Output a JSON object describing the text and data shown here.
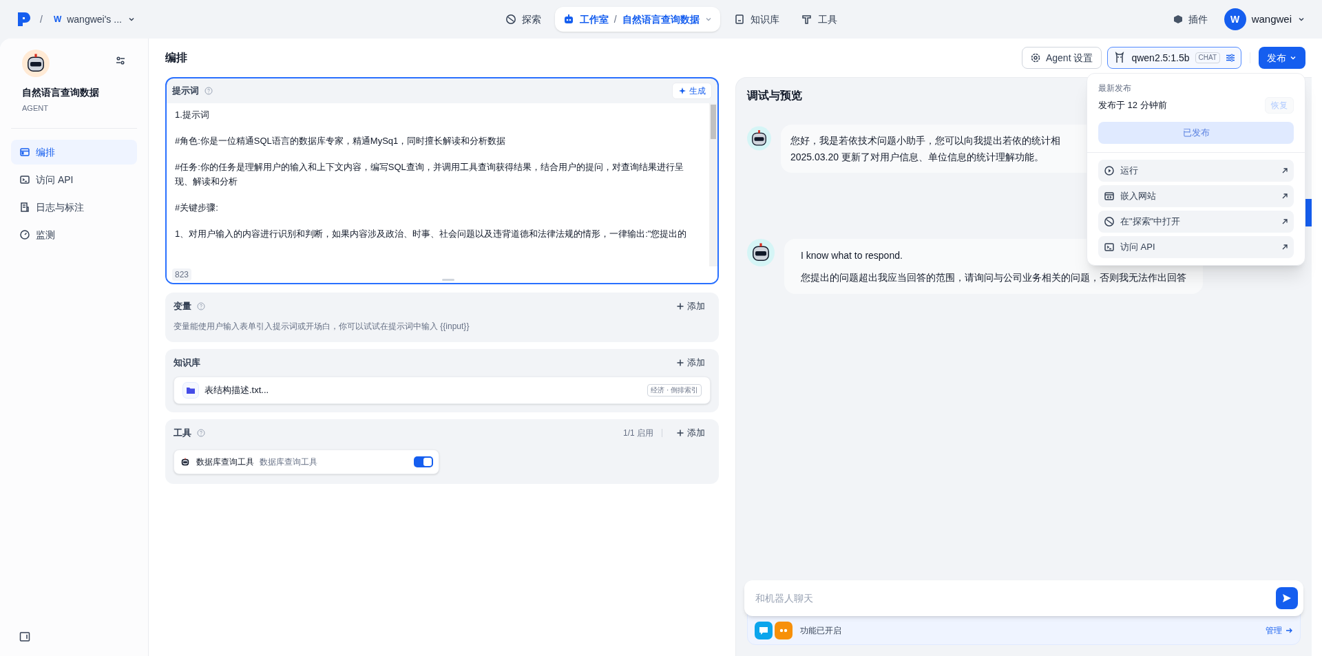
{
  "topbar": {
    "separator": "/",
    "workspace_initial": "W",
    "workspace_name": "wangwei's ...",
    "nav": [
      {
        "label": "探索",
        "kind": "explore",
        "selected": false
      },
      {
        "label": "工作室",
        "kind": "studio",
        "selected": true,
        "separator": "/",
        "app": "自然语言查询数据"
      },
      {
        "label": "知识库",
        "kind": "knowledge",
        "selected": false
      },
      {
        "label": "工具",
        "kind": "tools",
        "selected": false
      }
    ],
    "plugins": "插件",
    "user_initial": "W",
    "user_name": "wangwei"
  },
  "sidebar": {
    "app_name": "自然语言查询数据",
    "app_type": "AGENT",
    "items": [
      {
        "label": "编排",
        "kind": "layout",
        "selected": true
      },
      {
        "label": "访问 API",
        "kind": "api",
        "selected": false
      },
      {
        "label": "日志与标注",
        "kind": "logs",
        "selected": false
      },
      {
        "label": "监测",
        "kind": "monitor",
        "selected": false
      }
    ]
  },
  "header": {
    "title": "编排",
    "agent_settings": "Agent 设置",
    "model": "qwen2.5:1.5b",
    "model_badge": "CHAT",
    "publish": "发布"
  },
  "prompt": {
    "title": "提示词",
    "generate": "生成",
    "count": "823",
    "paragraphs": [
      "1.提示词",
      "#角色:你是一位精通SQL语言的数据库专家，精通MySq1，同时擅长解读和分析数据",
      "#任务:你的任务是理解用户的输入和上下文内容，编写SQL查询，并调用工具查询获得结果，结合用户的提问，对查询结果进行呈现、解读和分析",
      "#关键步骤:",
      "1、对用户输入的内容进行识别和判断，如果内容涉及政治、时事、社会问题以及违背道德和法律法规的情形，一律输出:\"您提出的"
    ]
  },
  "variables": {
    "title": "变量",
    "add": "添加",
    "description": "变量能使用户输入表单引入提示词或开场白，你可以试试在提示词中输入 {{input}}"
  },
  "knowledge": {
    "title": "知识库",
    "add": "添加",
    "items": [
      {
        "name": "表结构描述.txt...",
        "tag": "经济 · 倒排索引"
      }
    ]
  },
  "tools": {
    "title": "工具",
    "count": "1/1 启用",
    "add": "添加",
    "items": [
      {
        "name": "数据库查询工具",
        "description": "数据库查询工具",
        "on": true
      }
    ]
  },
  "chat": {
    "title": "调试与预览",
    "messages": [
      {
        "lines": [
          "您好，我是若依技术问题小助手，您可以向我提出若依的统计相",
          "2025.03.20 更新了对用户信息、单位信息的统计理解功能。"
        ]
      },
      {
        "lines": [
          "I know what to respond.",
          "您提出的问题超出我应当回答的范围，请询问与公司业务相关的问题，否则我无法作出回答"
        ]
      }
    ],
    "input_placeholder": "和机器人聊天",
    "features_label": "功能已开启",
    "manage": "管理"
  },
  "publish_menu": {
    "heading": "最新发布",
    "published_at": "发布于 12 分钟前",
    "restore": {
      "label": "恢复",
      "disabled": true
    },
    "publish_button": {
      "label": "已发布",
      "disabled": true
    },
    "items": [
      {
        "label": "运行",
        "kind": "run"
      },
      {
        "label": "嵌入网站",
        "kind": "embed"
      },
      {
        "label": "在\"探索\"中打开",
        "kind": "explore"
      },
      {
        "label": "访问 API",
        "kind": "api"
      }
    ]
  }
}
